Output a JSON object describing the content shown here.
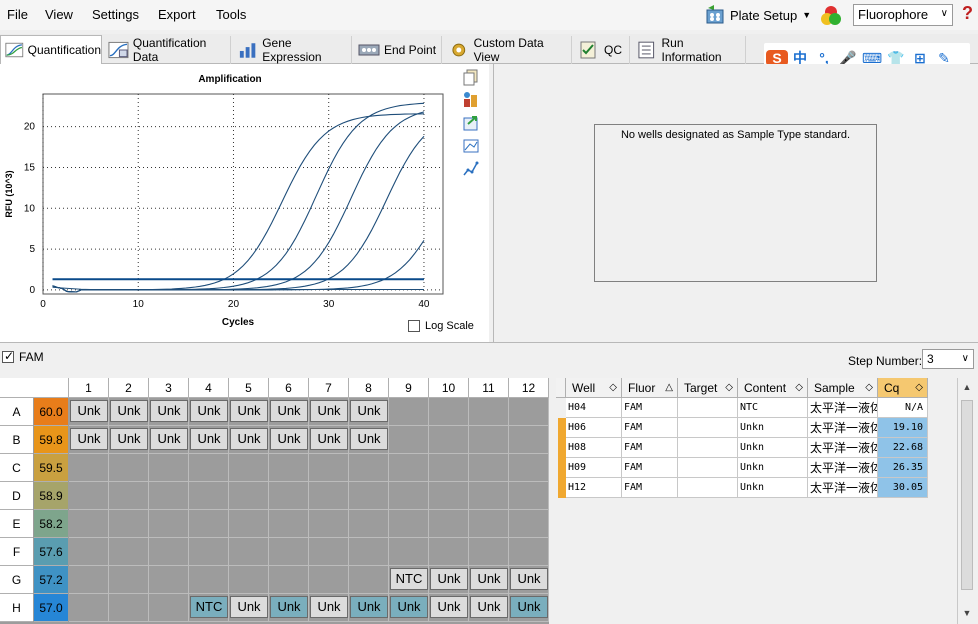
{
  "menu": [
    "File",
    "View",
    "Settings",
    "Export",
    "Tools"
  ],
  "plate_setup_label": "Plate Setup",
  "fluorophore": "Fluorophore",
  "help": "?",
  "tabs": [
    "Quantification",
    "Quantification Data",
    "Gene Expression",
    "End Point",
    "Custom Data View",
    "QC",
    "Run Information"
  ],
  "ime": [
    "S",
    "中",
    "°,",
    "🎤",
    "⌨",
    "👕",
    "⊞",
    "✎"
  ],
  "chart_data": {
    "type": "line",
    "title": "Amplification",
    "xlabel": "Cycles",
    "ylabel": "RFU (10^3)",
    "xlim": [
      0,
      42
    ],
    "ylim": [
      -0.5,
      24
    ],
    "xticks": [
      0,
      10,
      20,
      30,
      40
    ],
    "yticks": [
      0,
      5,
      10,
      15,
      20
    ],
    "grid": true,
    "series": [
      {
        "ct": 22.68,
        "plateau": 23.0
      },
      {
        "ct": 26.35,
        "plateau": 22.5
      },
      {
        "ct": 30.05,
        "plateau": 22.0
      },
      {
        "ct": 35.5,
        "plateau": 18.0
      },
      {
        "ct": 19.1,
        "plateau": 21.6
      }
    ],
    "threshold": 1.3
  },
  "log_scale_label": "Log Scale",
  "no_std_message": "No wells designated as Sample Type standard.",
  "fam_label": "FAM",
  "step_label": "Step Number:",
  "step_value": "3",
  "plate": {
    "cols": [
      "1",
      "2",
      "3",
      "4",
      "5",
      "6",
      "7",
      "8",
      "9",
      "10",
      "11",
      "12"
    ],
    "rows": [
      {
        "label": "A",
        "temp": "60.0",
        "color": "#e87d1a",
        "wells": [
          "Unk",
          "Unk",
          "Unk",
          "Unk",
          "Unk",
          "Unk",
          "Unk",
          "Unk",
          "",
          "",
          "",
          ""
        ]
      },
      {
        "label": "B",
        "temp": "59.8",
        "color": "#e8951a",
        "wells": [
          "Unk",
          "Unk",
          "Unk",
          "Unk",
          "Unk",
          "Unk",
          "Unk",
          "Unk",
          "",
          "",
          "",
          ""
        ]
      },
      {
        "label": "C",
        "temp": "59.5",
        "color": "#c9a040",
        "wells": [
          "",
          "",
          "",
          "",
          "",
          "",
          "",
          "",
          "",
          "",
          "",
          ""
        ]
      },
      {
        "label": "D",
        "temp": "58.9",
        "color": "#a6a46a",
        "wells": [
          "",
          "",
          "",
          "",
          "",
          "",
          "",
          "",
          "",
          "",
          "",
          ""
        ]
      },
      {
        "label": "E",
        "temp": "58.2",
        "color": "#7ea58c",
        "wells": [
          "",
          "",
          "",
          "",
          "",
          "",
          "",
          "",
          "",
          "",
          "",
          ""
        ]
      },
      {
        "label": "F",
        "temp": "57.6",
        "color": "#5a9db0",
        "wells": [
          "",
          "",
          "",
          "",
          "",
          "",
          "",
          "",
          "",
          "",
          "",
          ""
        ]
      },
      {
        "label": "G",
        "temp": "57.2",
        "color": "#3f92c4",
        "wells": [
          "",
          "",
          "",
          "",
          "",
          "",
          "",
          "",
          "NTC",
          "Unk",
          "Unk",
          "Unk"
        ]
      },
      {
        "label": "H",
        "temp": "57.0",
        "color": "#2686d6",
        "wells": [
          "",
          "",
          "",
          "NTC",
          "Unk",
          "Unk",
          "Unk",
          "Unk",
          "Unk",
          "Unk",
          "Unk",
          "Unk"
        ]
      }
    ],
    "blue_wells": [
      "H4",
      "H6",
      "H8",
      "H9",
      "H12"
    ]
  },
  "results": {
    "headers": [
      "Well",
      "Fluor",
      "Target",
      "Content",
      "Sample",
      "Cq"
    ],
    "rows": [
      {
        "well": "H04",
        "fluor": "FAM",
        "target": "",
        "content": "NTC",
        "sample": "太平洋一液体",
        "cq": "N/A"
      },
      {
        "well": "H06",
        "fluor": "FAM",
        "target": "",
        "content": "Unkn",
        "sample": "太平洋一液体",
        "cq": "19.10"
      },
      {
        "well": "H08",
        "fluor": "FAM",
        "target": "",
        "content": "Unkn",
        "sample": "太平洋一液体",
        "cq": "22.68"
      },
      {
        "well": "H09",
        "fluor": "FAM",
        "target": "",
        "content": "Unkn",
        "sample": "太平洋一液体",
        "cq": "26.35"
      },
      {
        "well": "H12",
        "fluor": "FAM",
        "target": "",
        "content": "Unkn",
        "sample": "太平洋一液体",
        "cq": "30.05"
      }
    ]
  },
  "colors": {
    "curve": "#1f4e7a",
    "accent_orange": "#f0a830",
    "blue_well": "#7aaebd",
    "cq_highlight": "#8fc3e8"
  }
}
